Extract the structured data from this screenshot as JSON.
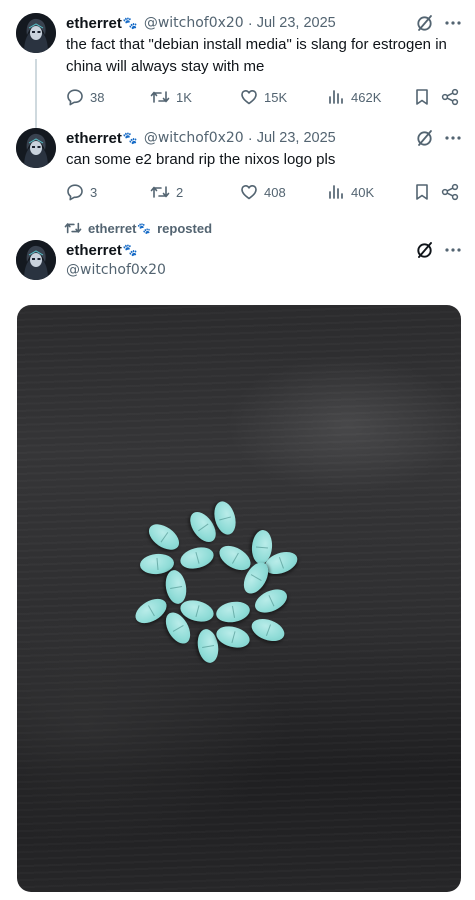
{
  "posts": [
    {
      "name": "etherret",
      "name_emoji": "🐾",
      "handle": "@witchof0x20",
      "separator": "·",
      "date": "Jul 23, 2025",
      "text": "the fact that \"debian install media\" is slang for estrogen in china will always stay with me",
      "replies": "38",
      "reposts": "1K",
      "likes": "15K",
      "views": "462K"
    },
    {
      "name": "etherret",
      "name_emoji": "🐾",
      "handle": "@witchof0x20",
      "separator": "·",
      "date": "Jul 23, 2025",
      "text": "can some e2 brand rip the nixos logo pls",
      "replies": "3",
      "reposts": "2",
      "likes": "408",
      "views": "40K"
    }
  ],
  "repost_bar": {
    "name": "etherret",
    "emoji": "🐾",
    "label": "reposted"
  },
  "third_post": {
    "name": "etherret",
    "name_emoji": "🐾",
    "handle": "@witchof0x20"
  },
  "icons": {
    "reply": "reply-icon",
    "repost": "repost-icon",
    "like": "heart-icon",
    "views": "views-icon",
    "bookmark": "bookmark-icon",
    "share": "share-icon",
    "grok": "grok-icon",
    "more": "more-icon"
  },
  "colors": {
    "text": "#0f1419",
    "secondary": "#536471",
    "thread_line": "#cfd9de",
    "pill": "#8fdcd7",
    "photo_bg": "#2e2e30"
  }
}
